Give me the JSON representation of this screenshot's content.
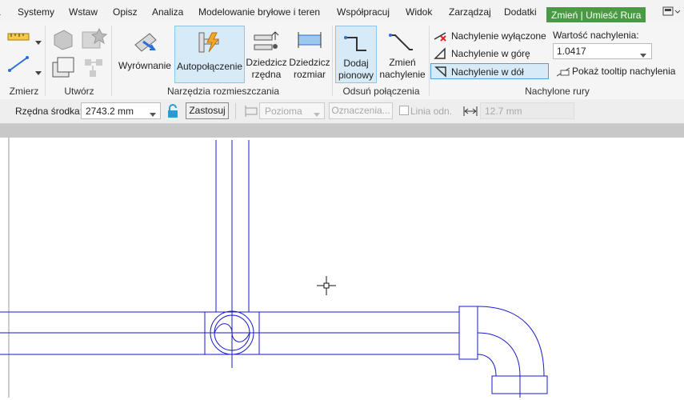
{
  "tabs": [
    "Systemy",
    "Wstaw",
    "Opisz",
    "Analiza",
    "Modelowanie bryłowe i teren",
    "Współpracuj",
    "Widok",
    "Zarządzaj",
    "Dodatki",
    "Zmień | Umieść Rura"
  ],
  "panels": {
    "modify": "Zmierz",
    "create": "Utwórz",
    "placement": "Narzędzia rozmieszczania",
    "offset": "Odsuń połączenia",
    "sloped": "Nachylone rury"
  },
  "buttons": {
    "justify": "Wyrównanie",
    "autoconnect": "Autopołączenie",
    "inherit_elev": [
      "Dziedzicz",
      "rzędna"
    ],
    "inherit_size": [
      "Dziedzicz",
      "rozmiar"
    ],
    "add_vertical": [
      "Dodaj",
      "pionowy"
    ],
    "change_slope": [
      "Zmień",
      "nachylenie"
    ]
  },
  "slope_options": [
    "Nachylenie wyłączone",
    "Nachylenie w górę",
    "Nachylenie w dół"
  ],
  "slope_value": {
    "label": "Wartość nachylenia:",
    "value": "1.0417"
  },
  "show_tooltip": "Pokaż tooltip nachylenia",
  "options_bar": {
    "elev_label": "Rzędna środka:",
    "elev_value": "2743.2 mm",
    "apply": "Zastosuj",
    "horizontal": "Pozioma",
    "tags": "Oznaczenia...",
    "line_label": "Linia odn.",
    "length": "12.7 mm"
  },
  "colors": {
    "pipe": "#1a1ad0",
    "active_tab": "#4a9a45",
    "selection": "#d6eaf8"
  }
}
